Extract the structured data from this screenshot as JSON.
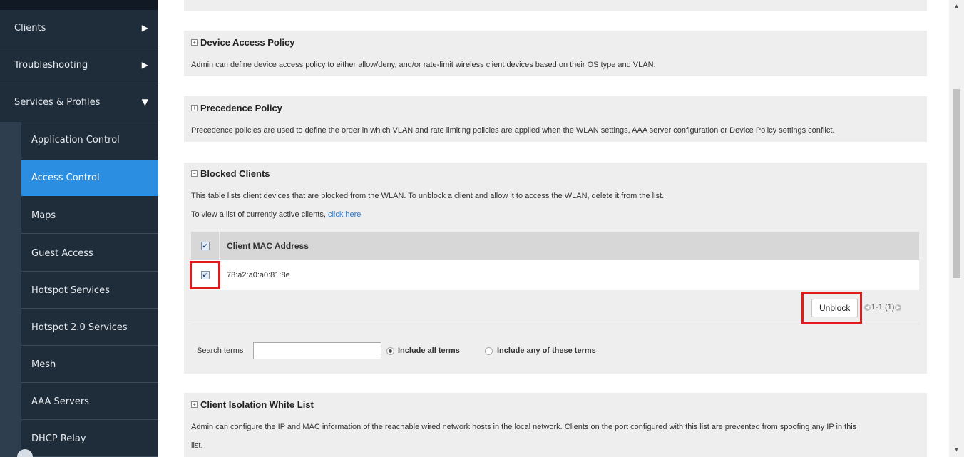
{
  "sidebar": {
    "top_items": [
      {
        "label": "Clients",
        "caret": "▶"
      },
      {
        "label": "Troubleshooting",
        "caret": "▶"
      },
      {
        "label": "Services & Profiles",
        "caret": "▼"
      }
    ],
    "sub_items": [
      {
        "label": "Application Control"
      },
      {
        "label": "Access Control"
      },
      {
        "label": "Maps"
      },
      {
        "label": "Guest Access"
      },
      {
        "label": "Hotspot Services"
      },
      {
        "label": "Hotspot 2.0 Services"
      },
      {
        "label": "Mesh"
      },
      {
        "label": "AAA Servers"
      },
      {
        "label": "DHCP Relay"
      }
    ],
    "active_item": "Access Control",
    "colors": {
      "background": "#1f2d3b",
      "active": "#2b8ee0"
    }
  },
  "panels": {
    "device_access": {
      "title": "Device Access Policy",
      "expander": "+",
      "description": "Admin can define device access policy to either allow/deny, and/or rate-limit wireless client devices based on their OS type and VLAN."
    },
    "precedence": {
      "title": "Precedence Policy",
      "expander": "+",
      "description": "Precedence policies are used to define the order in which VLAN and rate limiting policies are applied when the WLAN settings, AAA server configuration or Device Policy settings conflict."
    },
    "blocked": {
      "title": "Blocked Clients",
      "expander": "−",
      "description": "This table lists client devices that are blocked from the WLAN. To unblock a client and allow it to access the WLAN, delete it from the list.",
      "view_prefix": "To view a list of currently active clients, ",
      "view_link": "click here",
      "table": {
        "header": "Client MAC Address",
        "header_checked": true,
        "rows": [
          {
            "mac": "78:a2:a0:a0:81:8e",
            "checked": true
          }
        ]
      },
      "unblock_label": "Unblock",
      "pager": "1-1 (1)",
      "search": {
        "label": "Search terms",
        "value": "",
        "options": [
          {
            "label": "Include all terms",
            "selected": true
          },
          {
            "label": "Include any of these terms",
            "selected": false
          }
        ]
      }
    },
    "isolation": {
      "title": "Client Isolation White List",
      "expander": "+",
      "description": "Admin can configure the IP and MAC information of the reachable wired network hosts in the local network. Clients on the port configured with this list are prevented from spoofing any IP in this",
      "description_cont": "list."
    }
  },
  "highlight_color": "#e11b1b",
  "icons": {
    "checkbox": "checkmark-icon",
    "expand": "expand-icon",
    "collapse": "collapse-icon",
    "pager_prev": "prev-arrow-icon",
    "pager_next": "next-arrow-icon"
  }
}
